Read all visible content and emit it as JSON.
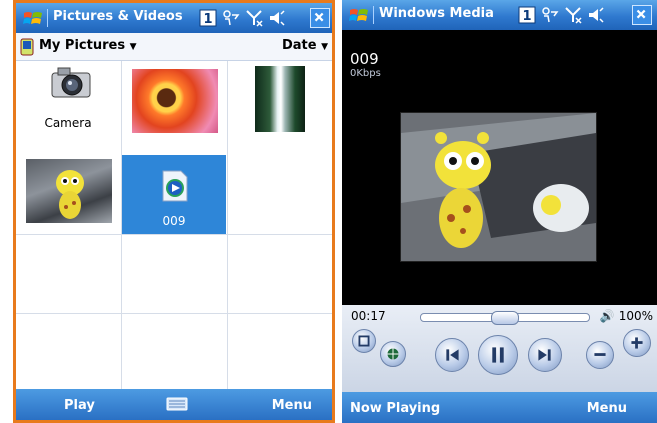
{
  "left_screen": {
    "title": "Pictures & Videos",
    "folder": "My Pictures",
    "sort": "Date",
    "items": [
      {
        "label": "Camera"
      },
      {
        "label": ""
      },
      {
        "label": ""
      },
      {
        "label": ""
      },
      {
        "label": "009"
      }
    ],
    "softkeys": {
      "left": "Play",
      "right": "Menu"
    }
  },
  "right_screen": {
    "title": "Windows Media",
    "track_title": "009",
    "bitrate": "0Kbps",
    "elapsed": "00:17",
    "volume": "100%",
    "playback_progress": 0.5,
    "softkeys": {
      "left": "Now Playing",
      "right": "Menu"
    }
  },
  "colors": {
    "titlebar": "#2f79cf",
    "frame_border": "#e87a1c",
    "selection": "#2e86d8"
  }
}
